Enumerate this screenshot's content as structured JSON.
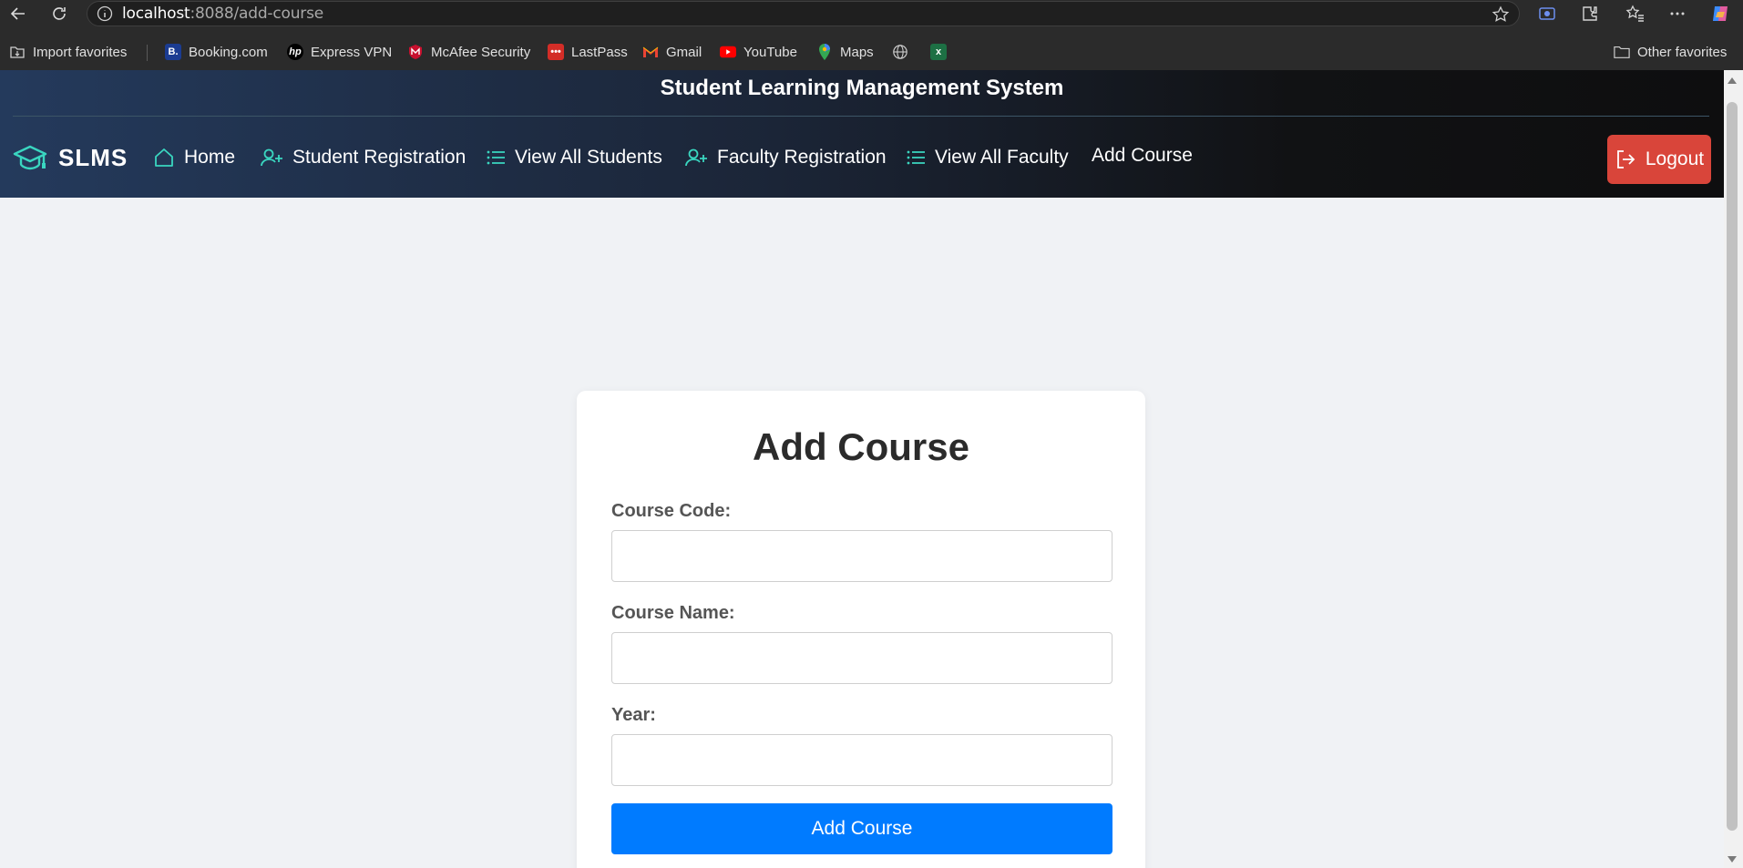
{
  "browser": {
    "url_host": "localhost",
    "url_port_path": ":8088/add-course",
    "favorites": [
      {
        "label": "Import favorites",
        "icon": "import-icon"
      },
      {
        "label": "Booking.com",
        "icon": "booking-icon"
      },
      {
        "label": "Express VPN",
        "icon": "hp-icon"
      },
      {
        "label": "McAfee Security",
        "icon": "mcafee-icon"
      },
      {
        "label": "LastPass",
        "icon": "lastpass-icon"
      },
      {
        "label": "Gmail",
        "icon": "gmail-icon"
      },
      {
        "label": "YouTube",
        "icon": "youtube-icon"
      },
      {
        "label": "Maps",
        "icon": "maps-icon"
      }
    ],
    "other_favorites": "Other favorites"
  },
  "header": {
    "title": "Student Learning Management System",
    "brand": "SLMS",
    "nav": {
      "home": "Home",
      "student_registration": "Student Registration",
      "view_all_students": "View All Students",
      "faculty_registration": "Faculty Registration",
      "view_all_faculty": "View All Faculty",
      "add_course": "Add Course"
    },
    "logout": "Logout",
    "accent_color": "#3ad6c0",
    "logout_color": "#d9453a"
  },
  "form": {
    "title": "Add Course",
    "fields": {
      "course_code": {
        "label": "Course Code:",
        "value": ""
      },
      "course_name": {
        "label": "Course Name:",
        "value": ""
      },
      "year": {
        "label": "Year:",
        "value": ""
      }
    },
    "submit": "Add Course",
    "submit_color": "#007bff"
  }
}
